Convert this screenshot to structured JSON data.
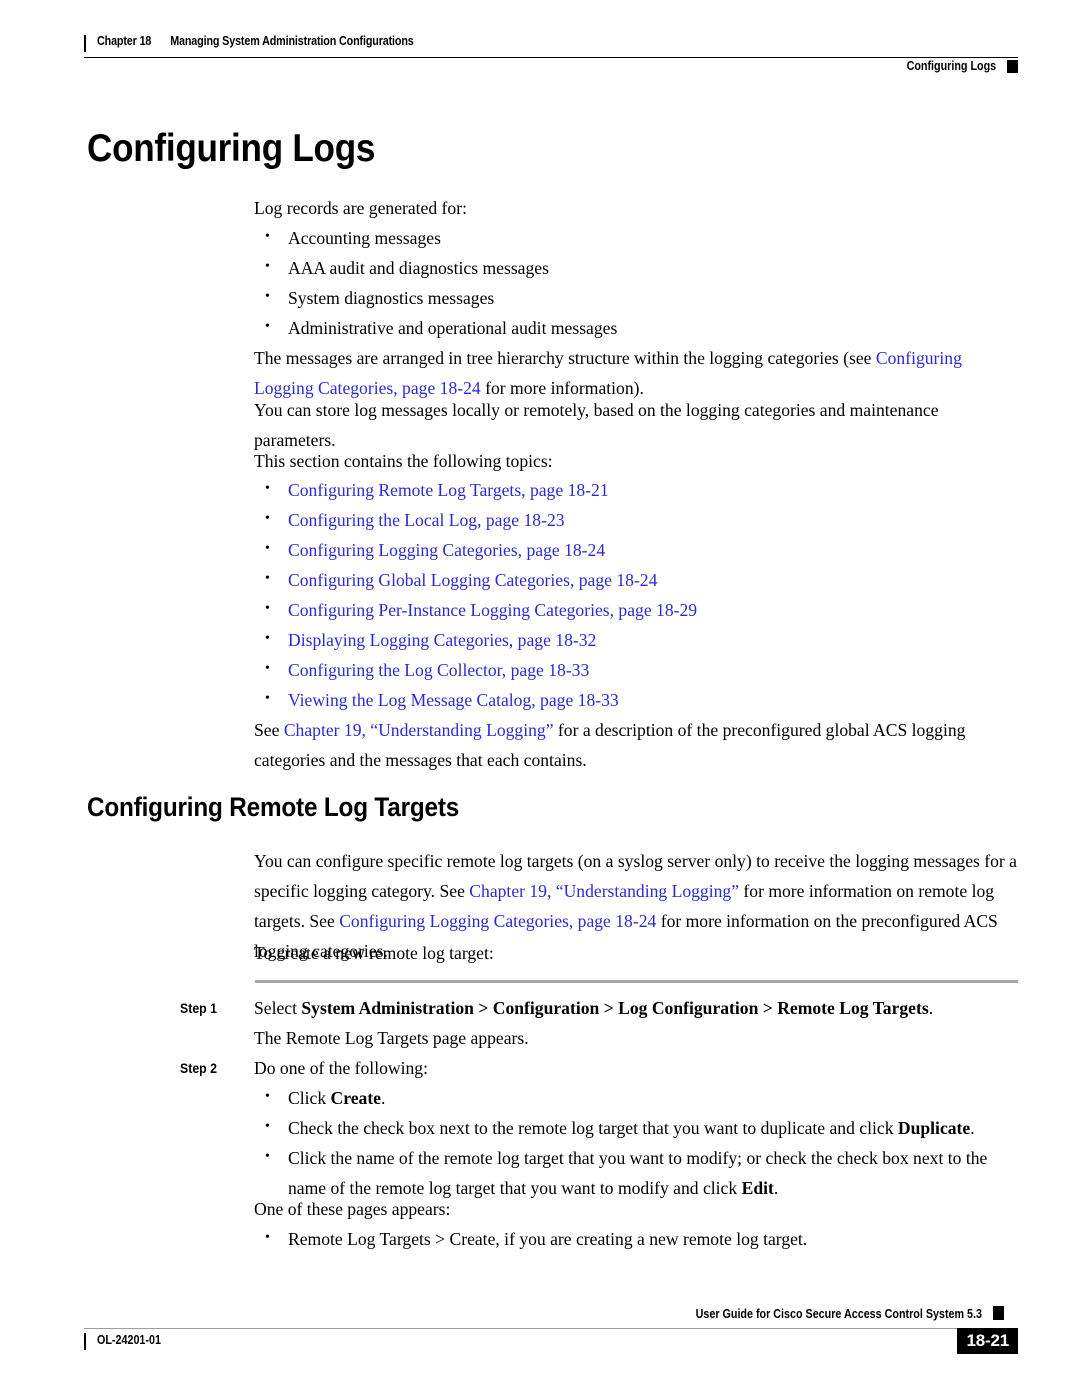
{
  "header": {
    "chapter": "Chapter 18",
    "chapter_title": "Managing System Administration Configurations",
    "section": "Configuring Logs"
  },
  "h1": "Configuring Logs",
  "intro": {
    "lead": "Log records are generated for:",
    "bullets": [
      "Accounting messages",
      "AAA audit and diagnostics messages",
      "System diagnostics messages",
      "Administrative and operational audit messages"
    ]
  },
  "para_tree": {
    "before": "The messages are arranged in tree hierarchy structure within the logging categories (see ",
    "link": "Configuring Logging Categories, page 18-24",
    "after": " for more information)."
  },
  "para_store": "You can store log messages locally or remotely, based on the logging categories and maintenance parameters.",
  "para_topics": "This section contains the following topics:",
  "topic_links": [
    "Configuring Remote Log Targets, page 18-21",
    "Configuring the Local Log, page 18-23",
    "Configuring Logging Categories, page 18-24",
    "Configuring Global Logging Categories, page 18-24",
    "Configuring Per-Instance Logging Categories, page 18-29",
    "Displaying Logging Categories, page 18-32",
    "Configuring the Log Collector, page 18-33",
    "Viewing the Log Message Catalog, page 18-33"
  ],
  "para_see_ch19": {
    "before": "See ",
    "link": "Chapter 19, “Understanding Logging”",
    "after": " for a description of the preconfigured global ACS logging categories and the messages that each contains."
  },
  "h2": "Configuring Remote Log Targets",
  "para_remote": {
    "p1": "You can configure specific remote log targets (on a syslog server only) to receive the logging messages for a specific logging category. See ",
    "link1": "Chapter 19, “Understanding Logging”",
    "p2": " for more information on remote log targets. See ",
    "link2": "Configuring Logging Categories, page 18-24",
    "p3": " for more information on the preconfigured ACS logging categories."
  },
  "para_create": "To create a new remote log target:",
  "steps": {
    "step1": {
      "label": "Step 1",
      "text_before": "Select ",
      "path": "System Administration > Configuration > Log Configuration > Remote Log Targets",
      "text_after": ".",
      "result": "The Remote Log Targets page appears."
    },
    "step2": {
      "label": "Step 2",
      "text": "Do one of the following:",
      "bullets": [
        {
          "before": "Click ",
          "bold": "Create",
          "after": "."
        },
        {
          "before": "Check the check box next to the remote log target that you want to duplicate and click ",
          "bold": "Duplicate",
          "after": "."
        },
        {
          "before": "Click the name of the remote log target that you want to modify; or check the check box next to the name of the remote log target that you want to modify and click ",
          "bold": "Edit",
          "after": "."
        }
      ],
      "result": "One of these pages appears:",
      "result_bullets": [
        "Remote Log Targets > Create, if you are creating a new remote log target."
      ]
    }
  },
  "footer": {
    "doc_id": "OL-24201-01",
    "guide_title": "User Guide for Cisco Secure Access Control System 5.3",
    "page_number": "18-21"
  },
  "colors": {
    "link": "#2b2bd4",
    "rule_gray": "#a6a6a6",
    "text": "#000000"
  }
}
